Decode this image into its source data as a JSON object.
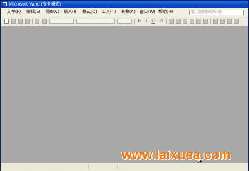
{
  "window": {
    "title": "Microsoft Word (安全模式)"
  },
  "menu": {
    "items": [
      {
        "label": "文件(F)"
      },
      {
        "label": "编辑(E)"
      },
      {
        "label": "视图(V)"
      },
      {
        "label": "插入(I)"
      },
      {
        "label": "格式(O)"
      },
      {
        "label": "工具(T)"
      },
      {
        "label": "表格(A)"
      },
      {
        "label": "窗口(W)"
      },
      {
        "label": "帮助(H)"
      }
    ],
    "help_placeholder": "键入需要帮助的问题"
  },
  "toolbar": {
    "bold_label": "B",
    "italic_label": "I",
    "underline_label": "U",
    "font_color_label": "A"
  },
  "watermark": {
    "text": "www.laixuea.com",
    "color": "#f47a07"
  },
  "colors": {
    "titlebar": "#0a4bc4",
    "workspace": "#a8a8a8",
    "chrome": "#ece9d8"
  }
}
